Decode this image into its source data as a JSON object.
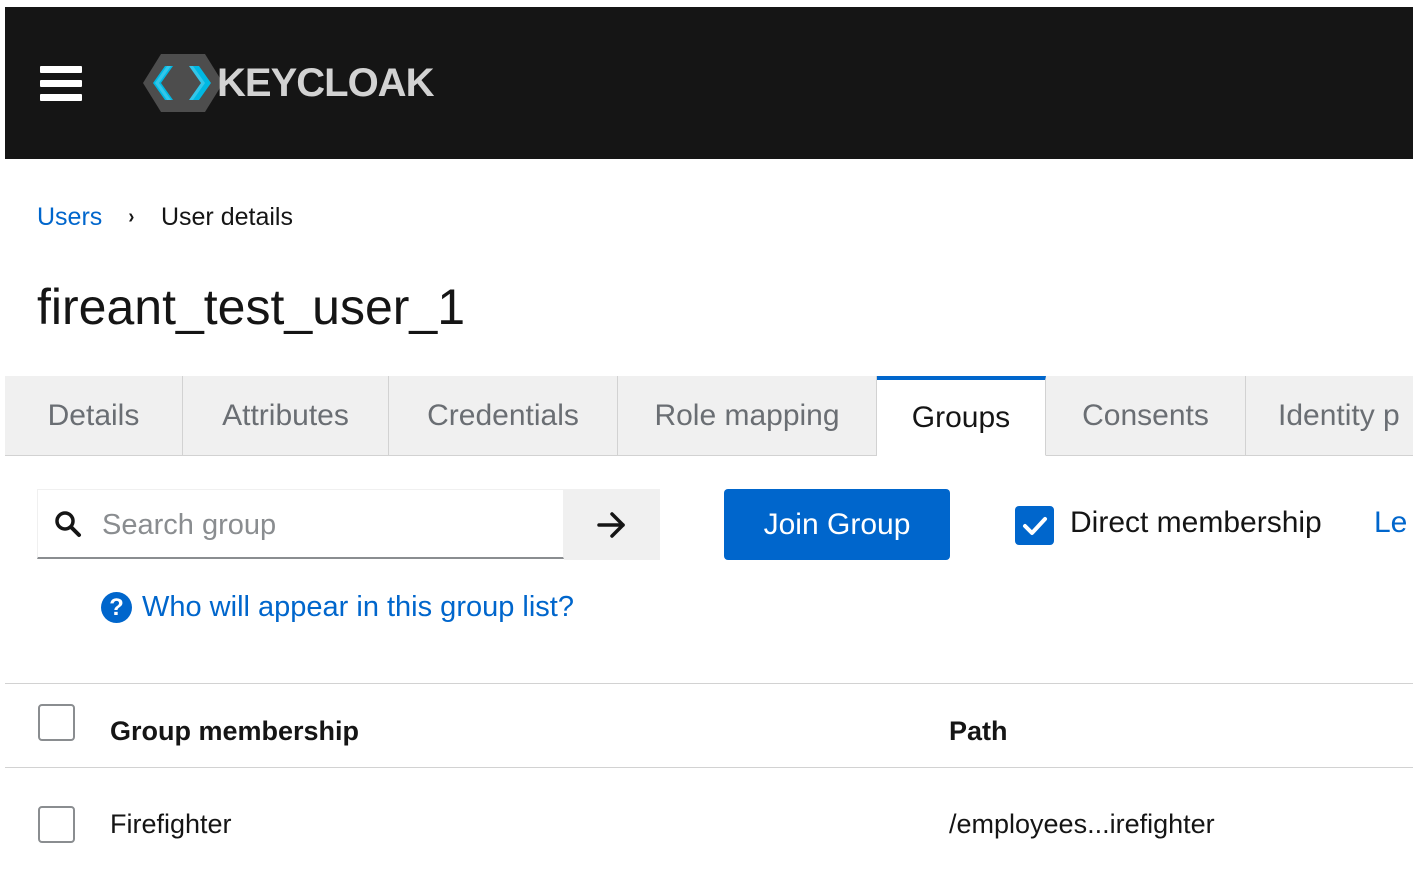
{
  "header": {
    "brand": "KEYCLOAK",
    "logo_icon": "keycloak-logo-icon",
    "menu_icon": "hamburger-menu-icon"
  },
  "breadcrumb": {
    "parent": "Users",
    "current": "User details"
  },
  "page": {
    "title": "fireant_test_user_1"
  },
  "tabs": [
    {
      "label": "Details",
      "active": false
    },
    {
      "label": "Attributes",
      "active": false
    },
    {
      "label": "Credentials",
      "active": false
    },
    {
      "label": "Role mapping",
      "active": false
    },
    {
      "label": "Groups",
      "active": true
    },
    {
      "label": "Consents",
      "active": false
    },
    {
      "label": "Identity p",
      "active": false
    }
  ],
  "toolbar": {
    "search_placeholder": "Search group",
    "search_value": "",
    "join_label": "Join Group",
    "direct_membership_label": "Direct membership",
    "direct_membership_checked": true,
    "leave_label": "Le"
  },
  "help": {
    "text": "Who will appear in this group list?"
  },
  "table": {
    "columns": [
      "Group membership",
      "Path"
    ],
    "rows": [
      {
        "name": "Firefighter",
        "path": "/employees...irefighter"
      }
    ]
  },
  "colors": {
    "accent": "#0066cc",
    "masthead": "#151515"
  }
}
